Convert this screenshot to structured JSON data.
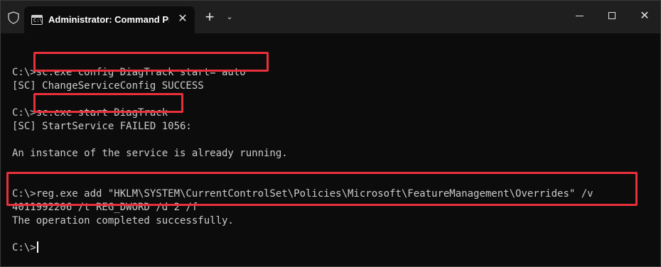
{
  "titlebar": {
    "tab_title": "Administrator: Command Prompt",
    "tab_icon_glyph": "C:\\",
    "close_tab_glyph": "✕",
    "new_tab_glyph": "+",
    "dropdown_glyph": "⌄",
    "window_close_glyph": "✕"
  },
  "terminal": {
    "lines": [
      "",
      "C:\\>sc.exe config DiagTrack start= auto",
      "[SC] ChangeServiceConfig SUCCESS",
      "",
      "C:\\>sc.exe start DiagTrack",
      "[SC] StartService FAILED 1056:",
      "",
      "An instance of the service is already running.",
      "",
      "",
      "C:\\>reg.exe add \"HKLM\\SYSTEM\\CurrentControlSet\\Policies\\Microsoft\\FeatureManagement\\Overrides\" /v",
      "4011992206 /t REG_DWORD /d 2 /f",
      "The operation completed successfully.",
      "",
      "C:\\>"
    ]
  },
  "colors": {
    "background": "#0c0c0c",
    "titlebar": "#1f1f1f",
    "text": "#cccccc",
    "highlight": "#e8303a"
  }
}
